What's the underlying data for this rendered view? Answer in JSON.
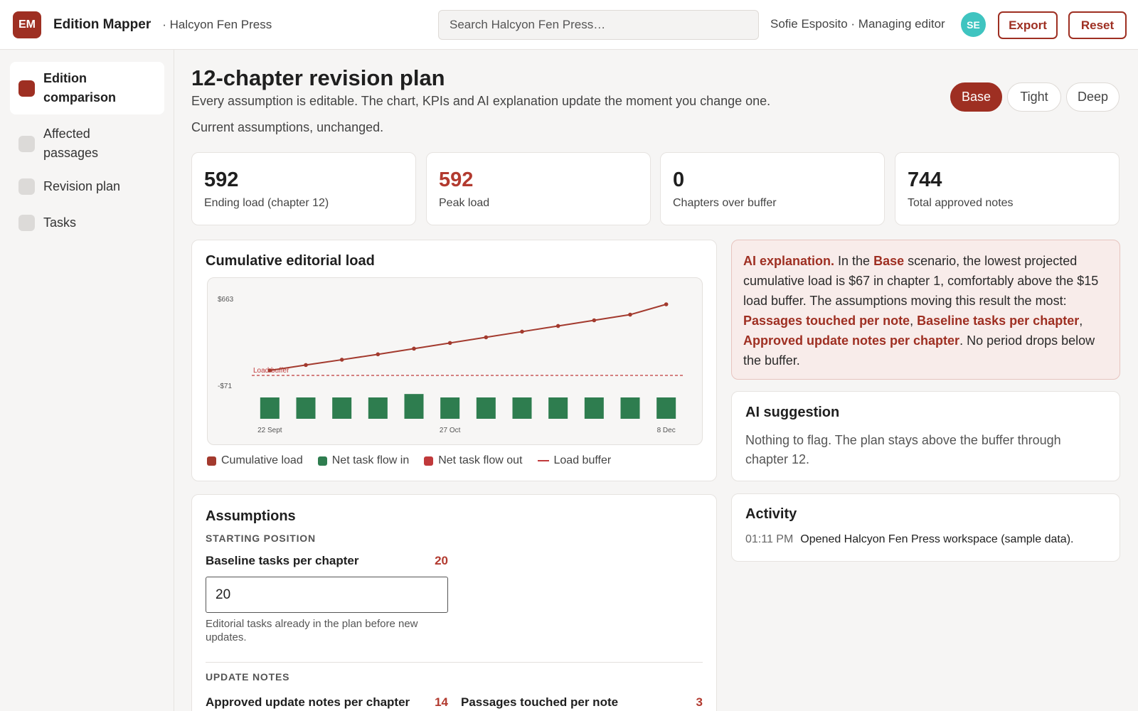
{
  "header": {
    "logo_text": "EM",
    "app_title": "Edition Mapper",
    "workspace": "· Halcyon Fen Press",
    "search_placeholder": "Search Halcyon Fen Press…",
    "user": "Sofie Esposito · Managing editor",
    "avatar_initials": "SE",
    "export_label": "Export",
    "reset_label": "Reset"
  },
  "sidebar": {
    "items": [
      {
        "label": "Edition comparison",
        "active": true
      },
      {
        "label": "Affected passages",
        "active": false
      },
      {
        "label": "Revision plan",
        "active": false
      },
      {
        "label": "Tasks",
        "active": false
      }
    ]
  },
  "main": {
    "title": "12-chapter revision plan",
    "subtitle": "Every assumption is editable. The chart, KPIs and AI explanation update the moment you change one.",
    "state": "Current assumptions, unchanged.",
    "scenarios": [
      "Base",
      "Tight",
      "Deep"
    ],
    "active_scenario": "Base"
  },
  "kpis": [
    {
      "value": "592",
      "label": "Ending load (chapter 12)",
      "warn": false
    },
    {
      "value": "592",
      "label": "Peak load",
      "warn": true
    },
    {
      "value": "0",
      "label": "Chapters over buffer",
      "warn": false
    },
    {
      "value": "744",
      "label": "Total approved notes",
      "warn": false
    }
  ],
  "chart": {
    "title": "Cumulative editorial load",
    "y_tick_top": "$663",
    "y_tick_low": "-$71",
    "buffer_label": "Load buffer",
    "x_labels": [
      "22 Sept",
      "27 Oct",
      "8 Dec"
    ],
    "legend": [
      "Cumulative load",
      "Net task flow in",
      "Net task flow out",
      "Load buffer"
    ],
    "colors": {
      "line": "#a33a2e",
      "bar_in": "#2e7d4f",
      "bar_out": "#c0393b",
      "buffer": "#c0393b"
    }
  },
  "chart_data": {
    "type": "bar",
    "categories": [
      "1",
      "2",
      "3",
      "4",
      "5",
      "6",
      "7",
      "8",
      "9",
      "10",
      "11",
      "12"
    ],
    "series": [
      {
        "name": "Cumulative load",
        "type": "line",
        "values": [
          67,
          110,
          152,
          195,
          240,
          285,
          330,
          375,
          420,
          465,
          510,
          592
        ]
      },
      {
        "name": "Net task flow in",
        "type": "bar",
        "values": [
          62,
          62,
          62,
          62,
          72,
          62,
          62,
          62,
          62,
          62,
          62,
          62
        ]
      },
      {
        "name": "Load buffer",
        "type": "reference",
        "value": 15
      }
    ],
    "x_tick_labels": [
      "22 Sept",
      "27 Oct",
      "8 Dec"
    ],
    "y_tick_labels": [
      "$663",
      "-$71"
    ],
    "ylim": [
      -71,
      663
    ],
    "grid": false,
    "legend_position": "bottom-left"
  },
  "ai": {
    "lead": "AI explanation.",
    "t1": " In the ",
    "scenario": "Base",
    "t2": " scenario, the lowest projected cumulative load is $67 in chapter 1, comfortably above the $15 load buffer. The assumptions moving this result the most: ",
    "h1": "Passages touched per note",
    "sep1": ", ",
    "h2": "Baseline tasks per chapter",
    "sep2": ", ",
    "h3": "Approved update notes per chapter",
    "t3": ". No period drops below the buffer."
  },
  "suggestion": {
    "title": "AI suggestion",
    "text": "Nothing to flag. The plan stays above the buffer through chapter 12."
  },
  "activity": {
    "title": "Activity",
    "time": "01:11 PM",
    "text": "Opened Halcyon Fen Press workspace (sample data)."
  },
  "assumptions": {
    "title": "Assumptions",
    "section1": "STARTING POSITION",
    "baseline_label": "Baseline tasks per chapter",
    "baseline_value": "20",
    "baseline_input": "20",
    "baseline_help": "Editorial tasks already in the plan before new updates.",
    "section2": "UPDATE NOTES",
    "notes_label": "Approved update notes per chapter",
    "notes_value": "14",
    "passages_label": "Passages touched per note",
    "passages_value": "3"
  }
}
